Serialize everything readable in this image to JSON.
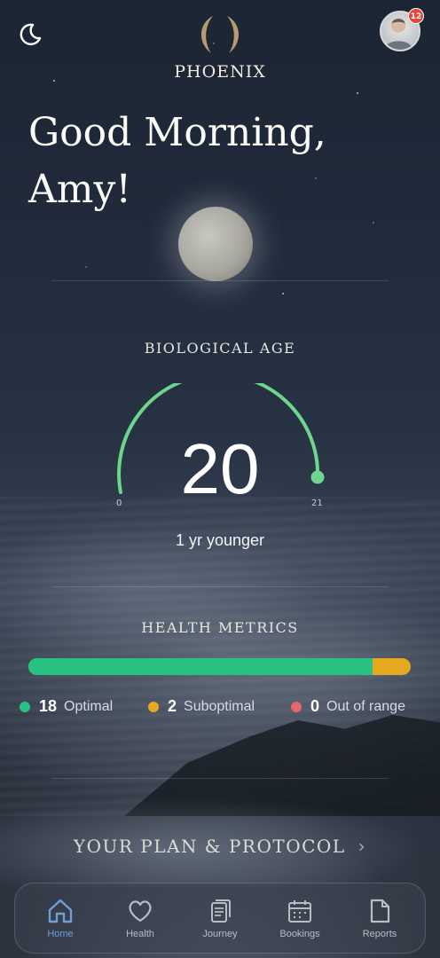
{
  "header": {
    "brand": "PHOENIX",
    "notification_count": "12",
    "theme_icon": "moon-icon",
    "avatar_icon": "user-avatar"
  },
  "greeting": {
    "line1": "Good Morning,",
    "line2": "Amy!"
  },
  "biological_age": {
    "title": "BIOLOGICAL AGE",
    "value": "20",
    "gauge_min": "0",
    "gauge_max": "21",
    "delta_text": "1 yr younger",
    "accent_color": "#6fd48c"
  },
  "health_metrics": {
    "title": "HEALTH METRICS",
    "optimal_fraction": 0.9,
    "legend": [
      {
        "count": "18",
        "label": "Optimal",
        "color": "#27c282"
      },
      {
        "count": "2",
        "label": "Suboptimal",
        "color": "#e5a81e"
      },
      {
        "count": "0",
        "label": "Out of range",
        "color": "#e8676b"
      }
    ]
  },
  "plan": {
    "label": "YOUR PLAN & PROTOCOL"
  },
  "tabs": [
    {
      "label": "Home",
      "icon": "home-icon",
      "active": true
    },
    {
      "label": "Health",
      "icon": "heart-icon",
      "active": false
    },
    {
      "label": "Journey",
      "icon": "journey-icon",
      "active": false
    },
    {
      "label": "Bookings",
      "icon": "calendar-icon",
      "active": false
    },
    {
      "label": "Reports",
      "icon": "document-icon",
      "active": false
    }
  ]
}
